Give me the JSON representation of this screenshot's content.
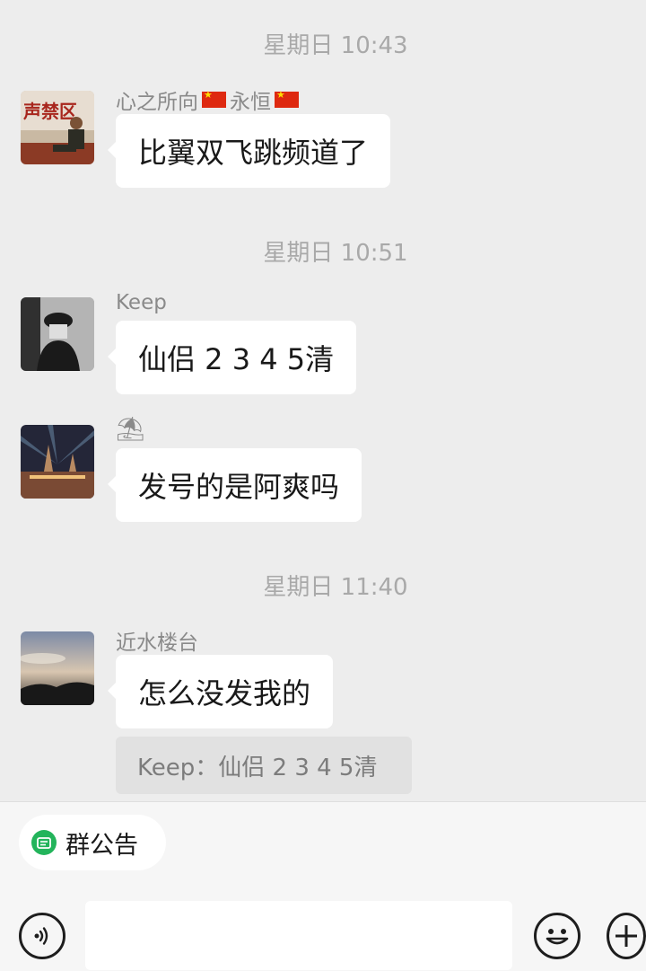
{
  "messages": [
    {
      "type": "time",
      "text": "星期日 10:43"
    },
    {
      "type": "msg",
      "sender": "心之所向",
      "sender2": "永恒",
      "text": "比翼双飞跳频道了"
    },
    {
      "type": "time",
      "text": "星期日 10:51"
    },
    {
      "type": "msg",
      "sender": "Keep",
      "text": "仙侣 2 3 4 5清"
    },
    {
      "type": "msg",
      "sender": "⛱",
      "text": "发号的是阿爽吗"
    },
    {
      "type": "time",
      "text": "星期日 11:40"
    },
    {
      "type": "msg",
      "sender": "近水楼台",
      "text": "怎么没发我的",
      "quote": "Keep：仙侣 2 3 4 5清"
    }
  ],
  "bottom_bar": {
    "group_notice_label": "群公告",
    "voice_icon": "voice-icon",
    "emoji_icon": "emoji-icon",
    "more_icon": "plus-icon"
  },
  "colors": {
    "background": "#ededed",
    "bubble": "#ffffff",
    "notice_icon": "#23b45b"
  }
}
